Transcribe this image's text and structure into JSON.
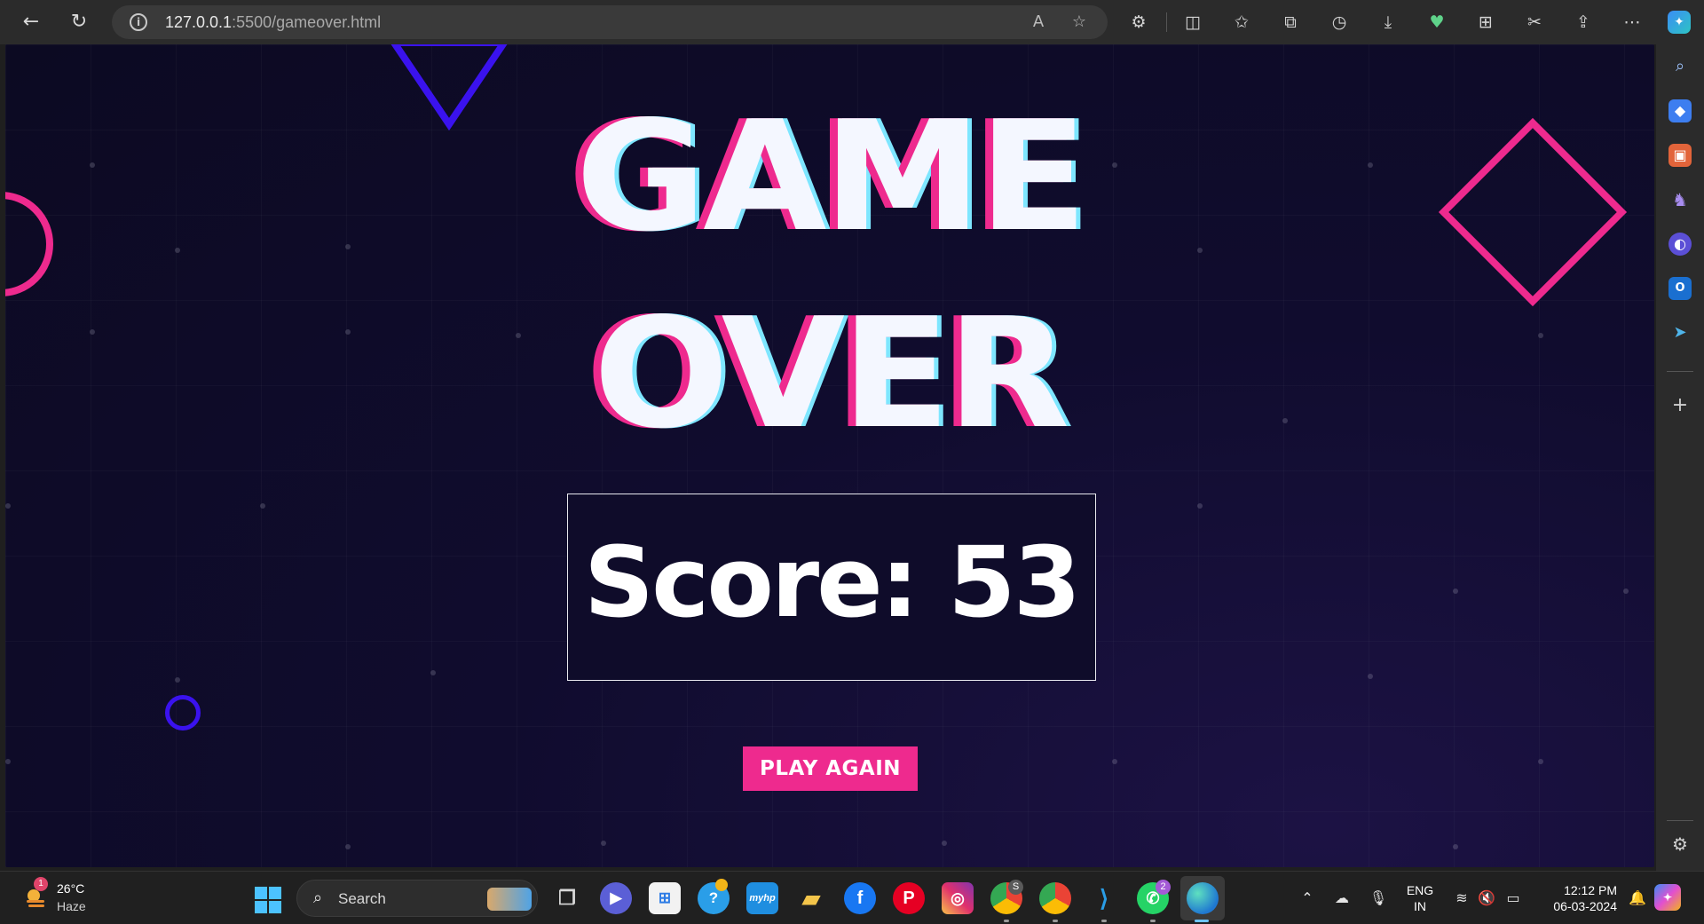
{
  "browser": {
    "url_host": "127.0.0.1",
    "url_path": ":5500/gameover.html"
  },
  "page": {
    "title_line1": "GAME",
    "title_line2": "OVER",
    "score_text": "Score: 53",
    "play_again_label": "PLAY AGAIN"
  },
  "taskbar": {
    "weather_temp": "26°C",
    "weather_condition": "Haze",
    "weather_badge": "1",
    "search_label": "Search",
    "chrome_badge": "S",
    "whatsapp_badge": "2",
    "language_line1": "ENG",
    "language_line2": "IN",
    "time": "12:12 PM",
    "date": "06-03-2024"
  },
  "colors": {
    "accent_pink": "#ee2a8e",
    "accent_blue": "#3a12ee",
    "page_background": "#0c0a22"
  }
}
